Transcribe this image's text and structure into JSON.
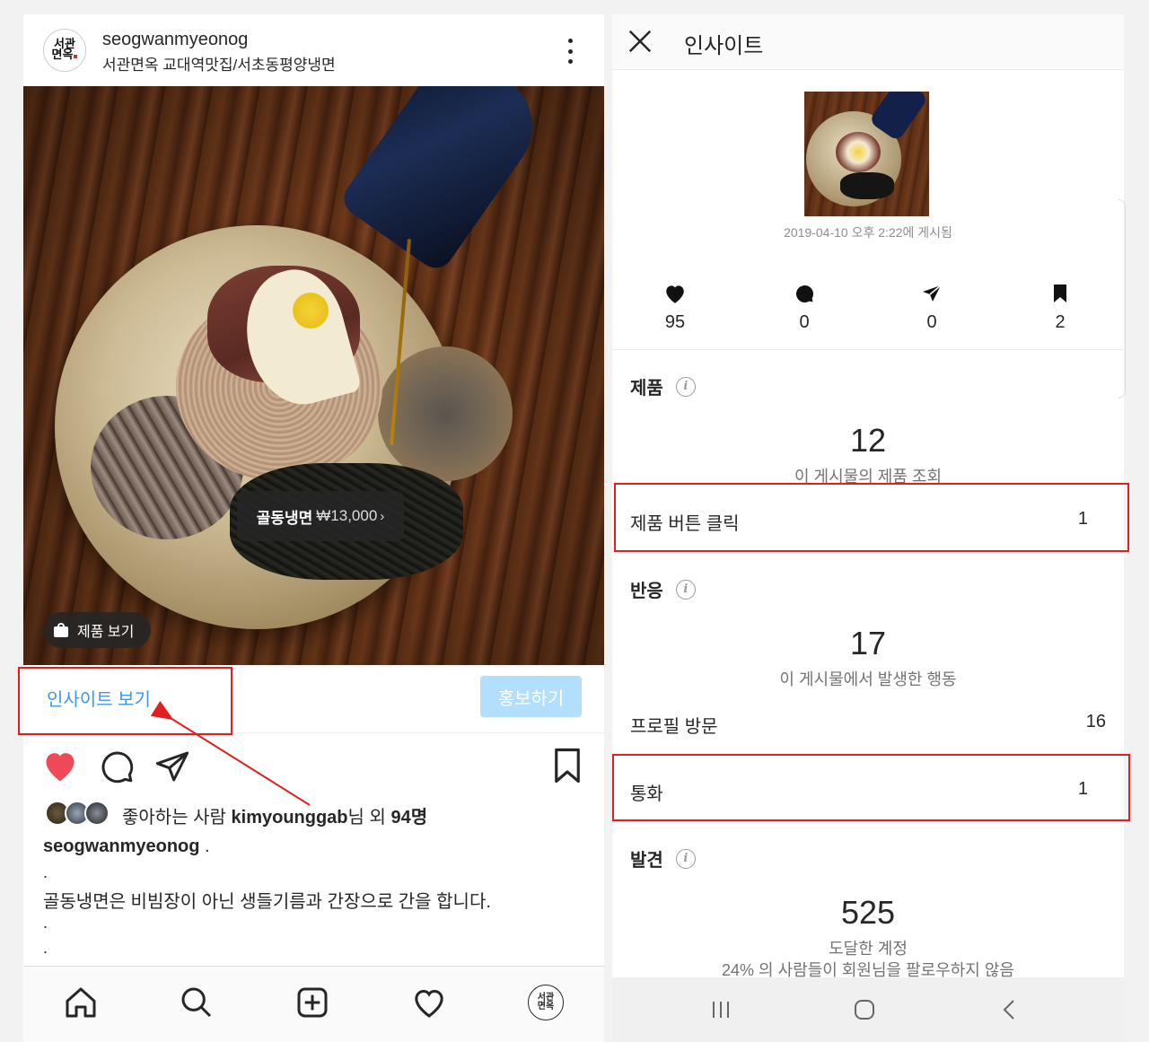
{
  "left": {
    "account": {
      "username": "seogwanmyeonog",
      "location": "서관면옥 교대역맛집/서초동평양냉면",
      "logo_text": "서관\n면옥"
    },
    "product_tag": {
      "name": "골동냉면",
      "price": "₩13,000",
      "chevron": "›"
    },
    "view_products_label": "제품 보기",
    "insight_link_label": "인사이트 보기",
    "promote_button_label": "홍보하기",
    "likes": {
      "prefix": "좋아하는 사람 ",
      "user": "kimyounggab",
      "middle": "님 외 ",
      "count": "94명"
    },
    "caption": {
      "username": "seogwanmyeonog",
      "suffix": " .",
      "dot": ".",
      "line": "골동냉면은 비빔장이 아닌 생들기름과 간장으로 간을 합니다."
    },
    "icons": [
      "home-icon",
      "search-icon",
      "add-post-icon",
      "activity-heart-icon",
      "profile-avatar-icon"
    ],
    "accent_color": "#3897f0",
    "like_color": "#ed4956"
  },
  "right": {
    "title": "인사이트",
    "posted_at": "2019-04-10 오후 2:22에 게시됨",
    "stats": {
      "likes": "95",
      "comments": "0",
      "shares": "0",
      "saves": "2"
    },
    "products": {
      "title": "제품",
      "total": "12",
      "subtitle": "이 게시물의 제품 조회",
      "button_clicks_label": "제품 버튼 클릭",
      "button_clicks_value": "1"
    },
    "interactions": {
      "title": "반응",
      "total": "17",
      "subtitle": "이 게시물에서 발생한 행동",
      "profile_visits_label": "프로필 방문",
      "profile_visits_value": "16",
      "calls_label": "통화",
      "calls_value": "1"
    },
    "discovery": {
      "title": "발견",
      "reach": "525",
      "reach_label": "도달한 계정",
      "non_follower_note": "24% 의 사람들이 회원님을 팔로우하지 않음"
    },
    "info_glyph": "i",
    "annotation_color": "#e02020"
  }
}
